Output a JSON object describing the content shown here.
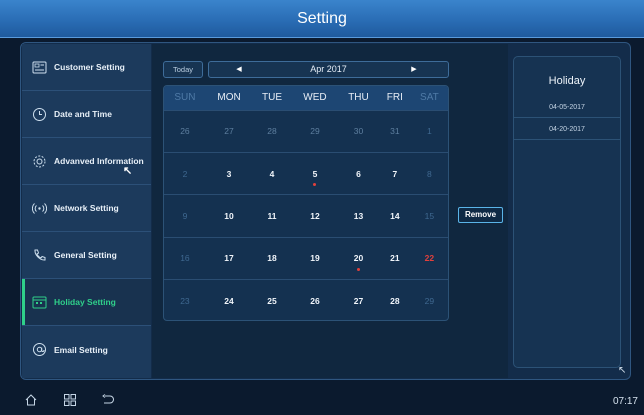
{
  "title": "Setting",
  "sidebar": {
    "items": [
      {
        "label": "Customer Setting",
        "icon": "customer-card-icon",
        "active": false
      },
      {
        "label": "Date and Time",
        "icon": "clock-icon",
        "active": false
      },
      {
        "label": "Advanved Information",
        "icon": "gear-icon",
        "active": false
      },
      {
        "label": "Network Setting",
        "icon": "wireless-icon",
        "active": false
      },
      {
        "label": "General Setting",
        "icon": "phone-icon",
        "active": false
      },
      {
        "label": "Holiday Setting",
        "icon": "calendar-icon",
        "active": true
      },
      {
        "label": "Email Setting",
        "icon": "email-at-icon",
        "active": false
      }
    ],
    "active_color": "#2fd08a"
  },
  "calendar": {
    "today_label": "Today",
    "month_label": "Apr  2017",
    "prev_icon": "triangle-left-icon",
    "next_icon": "triangle-right-icon",
    "weekdays": [
      "SUN",
      "MON",
      "TUE",
      "WED",
      "THU",
      "FRI",
      "SAT"
    ],
    "weeks": [
      [
        "26",
        "27",
        "28",
        "29",
        "30",
        "31",
        "1"
      ],
      [
        "2",
        "3",
        "4",
        "5",
        "6",
        "7",
        "8"
      ],
      [
        "9",
        "10",
        "11",
        "12",
        "13",
        "14",
        "15"
      ],
      [
        "16",
        "17",
        "18",
        "19",
        "20",
        "21",
        "22"
      ],
      [
        "23",
        "24",
        "25",
        "26",
        "27",
        "28",
        "29"
      ]
    ],
    "holiday_dates": [
      "5",
      "20"
    ],
    "highlight_date": "22",
    "holiday_color": "#e2403c"
  },
  "remove_label": "Remove",
  "holiday_panel": {
    "title": "Holiday",
    "items": [
      "04-05-2017",
      "04-20-2017"
    ]
  },
  "bottombar": {
    "icons": [
      "home-icon",
      "grid-icon",
      "back-icon"
    ],
    "time": "07:17"
  }
}
